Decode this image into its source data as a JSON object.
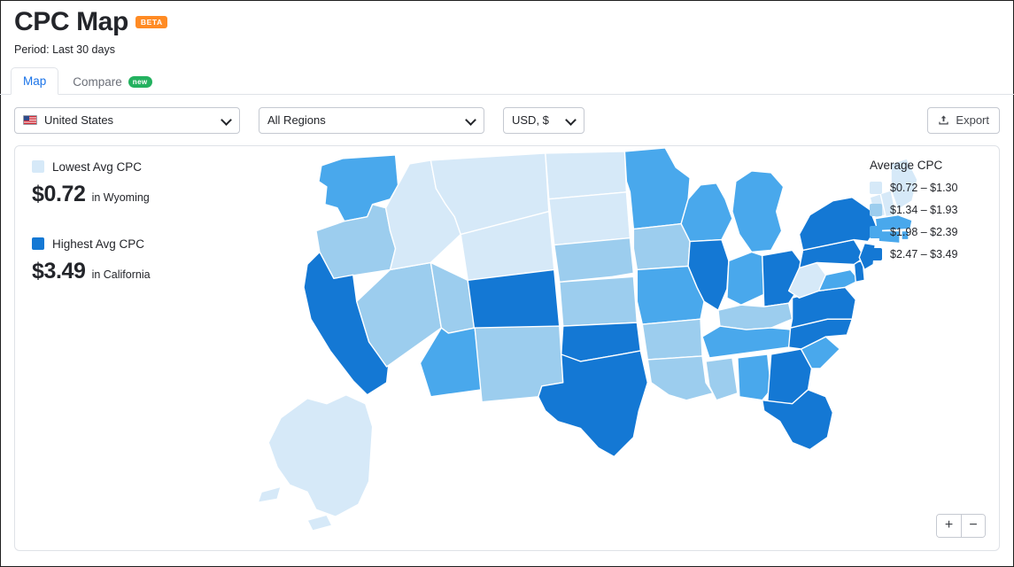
{
  "header": {
    "title": "CPC Map",
    "beta_badge": "BETA",
    "period": "Period: Last 30 days"
  },
  "tabs": [
    {
      "label": "Map",
      "active": true,
      "badge": ""
    },
    {
      "label": "Compare",
      "active": false,
      "badge": "new"
    }
  ],
  "controls": {
    "country": {
      "value": "United States",
      "icon": "us-flag-icon"
    },
    "region": {
      "value": "All Regions"
    },
    "currency": {
      "value": "USD, $"
    },
    "export": {
      "label": "Export",
      "icon": "upload-icon"
    }
  },
  "legend_left": {
    "lowest": {
      "label": "Lowest Avg CPC",
      "amount": "$0.72",
      "where": "in Wyoming",
      "color": "#d6e9f8"
    },
    "highest": {
      "label": "Highest Avg CPC",
      "amount": "$3.49",
      "where": "in California",
      "color": "#1478d4"
    }
  },
  "legend_right": {
    "title": "Average CPC",
    "bins": [
      {
        "label": "$0.72 – $1.30",
        "color": "#d6e9f8"
      },
      {
        "label": "$1.34 – $1.93",
        "color": "#9ccdee"
      },
      {
        "label": "$1.98 – $2.39",
        "color": "#49a8ec"
      },
      {
        "label": "$2.47 – $3.49",
        "color": "#1478d4"
      }
    ]
  },
  "zoom_controls": {
    "zoom_in": "+",
    "zoom_out": "−"
  },
  "chart_data": {
    "type": "heatmap",
    "title": "CPC Map",
    "subtitle": "Period: Last 30 days",
    "unit": "USD",
    "metric": "Average CPC",
    "min": {
      "state": "Wyoming",
      "value": 0.72
    },
    "max": {
      "state": "California",
      "value": 3.49
    },
    "bins": [
      {
        "range": [
          0.72,
          1.3
        ],
        "color": "#d6e9f8"
      },
      {
        "range": [
          1.34,
          1.93
        ],
        "color": "#9ccdee"
      },
      {
        "range": [
          1.98,
          2.39
        ],
        "color": "#49a8ec"
      },
      {
        "range": [
          2.47,
          3.49
        ],
        "color": "#1478d4"
      }
    ],
    "regions": [
      {
        "code": "CA",
        "name": "California",
        "bin": 3
      },
      {
        "code": "OR",
        "name": "Oregon",
        "bin": 1
      },
      {
        "code": "WA",
        "name": "Washington",
        "bin": 2
      },
      {
        "code": "NV",
        "name": "Nevada",
        "bin": 1
      },
      {
        "code": "ID",
        "name": "Idaho",
        "bin": 0
      },
      {
        "code": "MT",
        "name": "Montana",
        "bin": 0
      },
      {
        "code": "WY",
        "name": "Wyoming",
        "bin": 0
      },
      {
        "code": "UT",
        "name": "Utah",
        "bin": 1
      },
      {
        "code": "AZ",
        "name": "Arizona",
        "bin": 2
      },
      {
        "code": "CO",
        "name": "Colorado",
        "bin": 3
      },
      {
        "code": "NM",
        "name": "New Mexico",
        "bin": 1
      },
      {
        "code": "ND",
        "name": "North Dakota",
        "bin": 0
      },
      {
        "code": "SD",
        "name": "South Dakota",
        "bin": 0
      },
      {
        "code": "NE",
        "name": "Nebraska",
        "bin": 1
      },
      {
        "code": "KS",
        "name": "Kansas",
        "bin": 1
      },
      {
        "code": "OK",
        "name": "Oklahoma",
        "bin": 3
      },
      {
        "code": "TX",
        "name": "Texas",
        "bin": 3
      },
      {
        "code": "MN",
        "name": "Minnesota",
        "bin": 2
      },
      {
        "code": "IA",
        "name": "Iowa",
        "bin": 1
      },
      {
        "code": "MO",
        "name": "Missouri",
        "bin": 2
      },
      {
        "code": "AR",
        "name": "Arkansas",
        "bin": 1
      },
      {
        "code": "LA",
        "name": "Louisiana",
        "bin": 1
      },
      {
        "code": "WI",
        "name": "Wisconsin",
        "bin": 2
      },
      {
        "code": "IL",
        "name": "Illinois",
        "bin": 3
      },
      {
        "code": "MI",
        "name": "Michigan",
        "bin": 2
      },
      {
        "code": "IN",
        "name": "Indiana",
        "bin": 2
      },
      {
        "code": "OH",
        "name": "Ohio",
        "bin": 3
      },
      {
        "code": "KY",
        "name": "Kentucky",
        "bin": 1
      },
      {
        "code": "TN",
        "name": "Tennessee",
        "bin": 2
      },
      {
        "code": "MS",
        "name": "Mississippi",
        "bin": 1
      },
      {
        "code": "AL",
        "name": "Alabama",
        "bin": 2
      },
      {
        "code": "GA",
        "name": "Georgia",
        "bin": 3
      },
      {
        "code": "FL",
        "name": "Florida",
        "bin": 3
      },
      {
        "code": "SC",
        "name": "South Carolina",
        "bin": 2
      },
      {
        "code": "NC",
        "name": "North Carolina",
        "bin": 3
      },
      {
        "code": "VA",
        "name": "Virginia",
        "bin": 3
      },
      {
        "code": "WV",
        "name": "West Virginia",
        "bin": 0
      },
      {
        "code": "MD",
        "name": "Maryland",
        "bin": 2
      },
      {
        "code": "DE",
        "name": "Delaware",
        "bin": 3
      },
      {
        "code": "PA",
        "name": "Pennsylvania",
        "bin": 3
      },
      {
        "code": "NJ",
        "name": "New Jersey",
        "bin": 3
      },
      {
        "code": "NY",
        "name": "New York",
        "bin": 3
      },
      {
        "code": "CT",
        "name": "Connecticut",
        "bin": 2
      },
      {
        "code": "RI",
        "name": "Rhode Island",
        "bin": 2
      },
      {
        "code": "MA",
        "name": "Massachusetts",
        "bin": 2
      },
      {
        "code": "VT",
        "name": "Vermont",
        "bin": 0
      },
      {
        "code": "NH",
        "name": "New Hampshire",
        "bin": 0
      },
      {
        "code": "ME",
        "name": "Maine",
        "bin": 0
      },
      {
        "code": "AK",
        "name": "Alaska",
        "bin": 0
      }
    ]
  }
}
